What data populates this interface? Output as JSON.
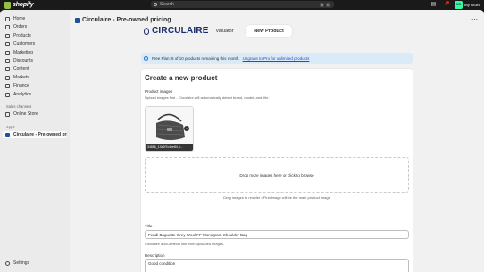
{
  "topbar": {
    "logo_text": "shopify",
    "search_placeholder": "Search",
    "kbd_1": "⌘",
    "kbd_2": "K",
    "avatar_initials": "MS",
    "store_name": "My Store"
  },
  "sidebar": {
    "items": [
      {
        "label": "Home",
        "icon": "home-icon"
      },
      {
        "label": "Orders",
        "icon": "orders-icon"
      },
      {
        "label": "Products",
        "icon": "products-icon"
      },
      {
        "label": "Customers",
        "icon": "customers-icon"
      },
      {
        "label": "Marketing",
        "icon": "marketing-icon"
      },
      {
        "label": "Discounts",
        "icon": "discounts-icon"
      },
      {
        "label": "Content",
        "icon": "content-icon"
      },
      {
        "label": "Markets",
        "icon": "markets-icon"
      },
      {
        "label": "Finance",
        "icon": "finance-icon"
      },
      {
        "label": "Analytics",
        "icon": "analytics-icon"
      }
    ],
    "sales_channels_label": "Sales channels",
    "online_store_label": "Online Store",
    "apps_label": "Apps",
    "app_item_label": "Circulaire - Pre-owned pric...",
    "settings_label": "Settings"
  },
  "app_header": {
    "title": "Circulaire - Pre-owned pricing",
    "more": "⋯"
  },
  "app": {
    "brand": "CIRCULAIRE",
    "tabs": [
      {
        "label": "Valuator",
        "active": false
      },
      {
        "label": "New Product",
        "active": true
      }
    ],
    "banner_text": "Free Plan: 8 of 10 products remaining this month.",
    "banner_link": "Upgrade to Pro for unlimited products",
    "card_title": "Create a new product",
    "product_images_label": "Product images",
    "product_images_help": "Upload images first - Circulaire will automatically detect brand, model, and title",
    "thumb_caption": "34886_13a2f7c4ee84.jt...",
    "thumb_remove": "×",
    "dropzone_text": "Drop more images here or click to browse",
    "dropzone_hint": "Drag images to reorder • First image will be the main product image",
    "title_label": "Title",
    "title_value": "Fendi Baguette Grey Wool FF Monogram Shoulder Bag",
    "title_help": "Circulaire auto-detects title from uploaded images.",
    "description_label": "Description",
    "description_value": "Good condition"
  },
  "colors": {
    "brand_navy": "#1a2b6d",
    "banner_bg": "#dbeaf7",
    "link": "#2c4abe",
    "avatar": "#36fba1",
    "shopify_green": "#95bf47"
  }
}
